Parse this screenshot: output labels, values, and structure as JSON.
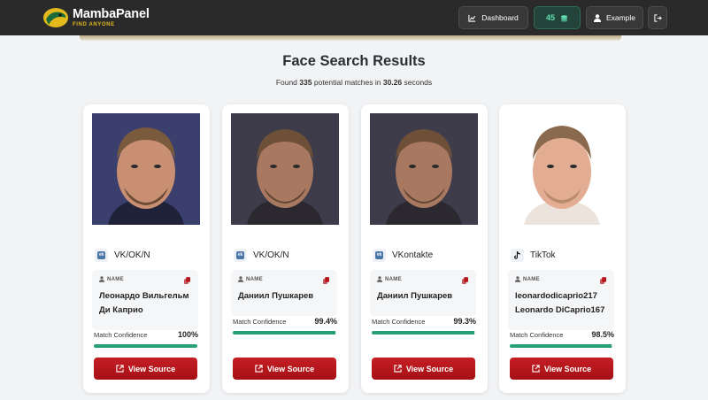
{
  "header": {
    "brand": "MambaPanel",
    "tagline": "FIND ANYONE",
    "dashboard_label": "Dashboard",
    "credits": "45",
    "user_label": "Example"
  },
  "page": {
    "title": "Face Search Results",
    "summary_prefix": "Found",
    "summary_count": "335",
    "summary_mid": "potential matches in",
    "summary_time": "30.26",
    "summary_suffix": "seconds"
  },
  "labels": {
    "name_label": "NAME",
    "confidence_label": "Match Confidence",
    "view_source": "View Source"
  },
  "results": [
    {
      "platform": "VK/OK/N",
      "platform_icon": "vk-icon",
      "name_line1": "Леонардо Вильгельм",
      "name_line2": "Ди Каприо",
      "confidence": "100%",
      "confidence_value": 100
    },
    {
      "platform": "VK/OK/N",
      "platform_icon": "vk-icon",
      "name_line1": "Даниил Пушкарев",
      "name_line2": "",
      "confidence": "99.4%",
      "confidence_value": 99.4
    },
    {
      "platform": "VKontakte",
      "platform_icon": "vk-icon",
      "name_line1": "Даниил Пушкарев",
      "name_line2": "",
      "confidence": "99.3%",
      "confidence_value": 99.3
    },
    {
      "platform": "TikTok",
      "platform_icon": "tiktok-icon",
      "name_line1": "leonardodicaprio217",
      "name_line2": "Leonardo DiCaprio167",
      "confidence": "98.5%",
      "confidence_value": 98.5
    }
  ],
  "colors": {
    "accent": "#b5161b",
    "progress": "#27a07a",
    "header_bg": "#2a2a2a",
    "credits": "#5fe0b0"
  }
}
